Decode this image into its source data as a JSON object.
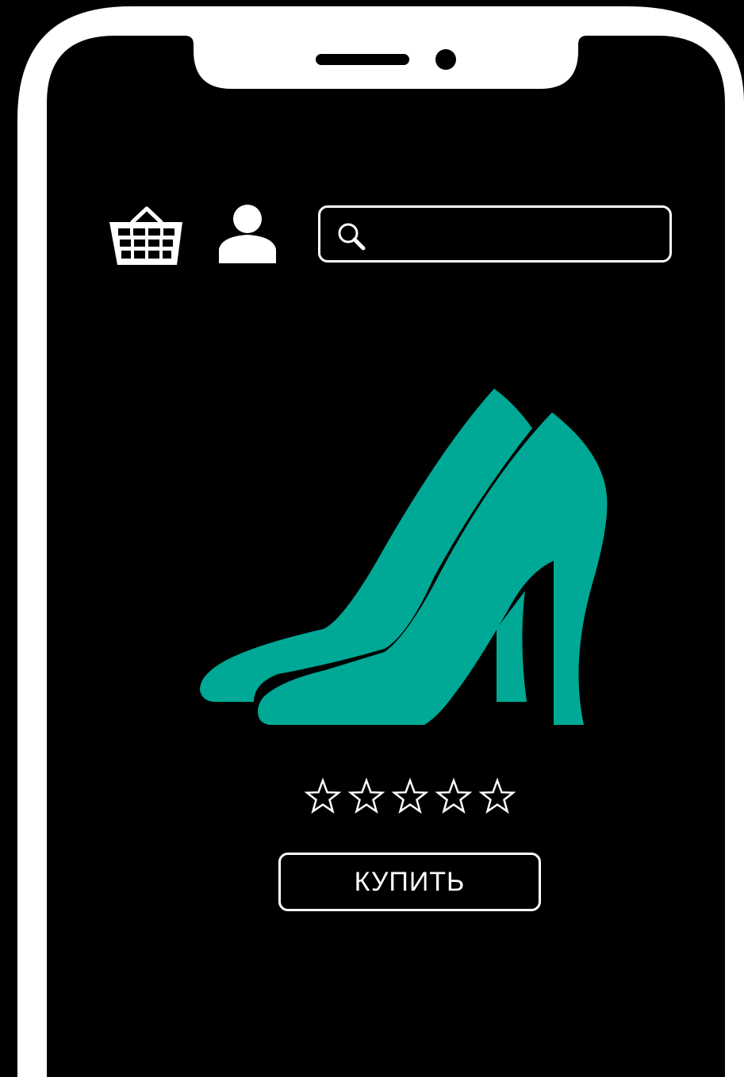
{
  "colors": {
    "background": "#000000",
    "frame": "#ffffff",
    "product": "#00a896"
  },
  "header": {
    "cart_icon": "basket-icon",
    "profile_icon": "user-icon",
    "search": {
      "icon": "magnifier-icon",
      "placeholder": "",
      "value": ""
    }
  },
  "product": {
    "image_icon": "high-heel-shoes-icon",
    "rating": {
      "value": 0,
      "max": 5,
      "icon": "star-outline-icon"
    },
    "buy_label": "КУПИТЬ"
  }
}
